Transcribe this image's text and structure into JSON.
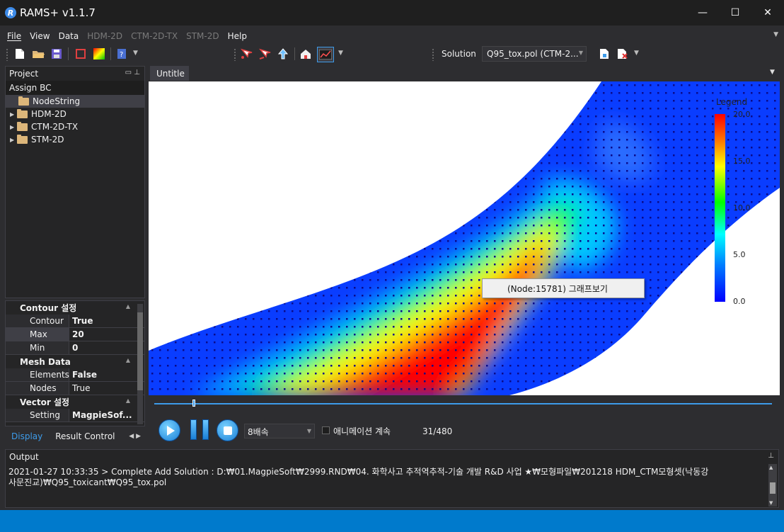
{
  "app": {
    "title": "RAMS+ v1.1.7",
    "icon": "R"
  },
  "window_buttons": {
    "minimize": "—",
    "maximize": "☐",
    "close": "✕"
  },
  "menu": [
    {
      "label": "File",
      "enabled": true
    },
    {
      "label": "View",
      "enabled": true
    },
    {
      "label": "Data",
      "enabled": true
    },
    {
      "label": "HDM-2D",
      "enabled": false
    },
    {
      "label": "CTM-2D-TX",
      "enabled": false
    },
    {
      "label": "STM-2D",
      "enabled": false
    },
    {
      "label": "Help",
      "enabled": true
    }
  ],
  "toolbar": {
    "solution_label": "Solution",
    "solution_value": "Q95_tox.pol (CTM-2..."
  },
  "project": {
    "title": "Project",
    "assign_bc": "Assign BC",
    "tree": [
      {
        "label": "NodeString",
        "expandable": false,
        "selected": true
      },
      {
        "label": "HDM-2D",
        "expandable": true,
        "selected": false
      },
      {
        "label": "CTM-2D-TX",
        "expandable": true,
        "selected": false
      },
      {
        "label": "STM-2D",
        "expandable": true,
        "selected": false
      }
    ]
  },
  "properties": {
    "contour": {
      "title": "Contour 설정",
      "rows": [
        {
          "name": "Contour",
          "value": "True"
        },
        {
          "name": "Max",
          "value": "20"
        },
        {
          "name": "Min",
          "value": "0"
        }
      ]
    },
    "mesh": {
      "title": "Mesh Data",
      "rows": [
        {
          "name": "Elements",
          "value": "False"
        },
        {
          "name": "Nodes",
          "value": "True"
        }
      ]
    },
    "vector": {
      "title": "Vector 설정",
      "rows": [
        {
          "name": "Setting",
          "value": "MagpieSof..."
        }
      ]
    }
  },
  "bottom_tabs": {
    "display": "Display",
    "result_control": "Result Control"
  },
  "document": {
    "tab": "Untitle"
  },
  "legend": {
    "title": "Legend",
    "ticks": [
      "20.0",
      "15.0",
      "10.0",
      "5.0",
      "0.0"
    ]
  },
  "context_menu": {
    "label": "(Node:15781) 그래프보기"
  },
  "animation": {
    "speed": "8배속",
    "continue_label": "애니메이션 계속",
    "frame": "31/480",
    "progress": 0.0646
  },
  "output": {
    "title": "Output",
    "line1": "2021-01-27 10:33:35 > Complete Add Solution : D:₩01.MagpieSoft₩2999.RND₩04. 화학사고 추적역추적-기술 개발 R&D 사업 ★₩모형파일₩201218 HDM_CTM모형셋(낙동강",
    "line2": "사문진교)₩Q95_toxicant₩Q95_tox.pol"
  },
  "colors": {
    "accent": "#007acc",
    "background": "#2d2d30"
  }
}
